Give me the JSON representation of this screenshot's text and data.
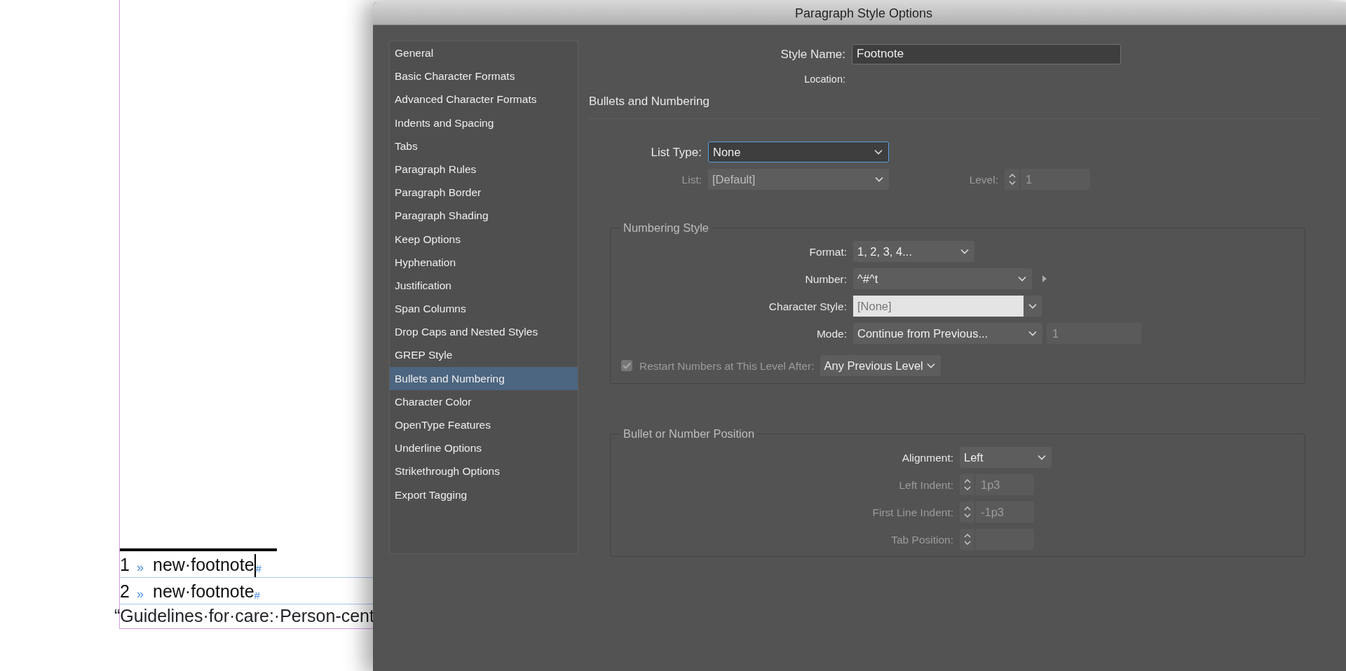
{
  "document": {
    "footnotes": [
      {
        "number": "1",
        "tab_mark": "»",
        "text": "new·footnote",
        "end_mark": "#",
        "cursor": true
      },
      {
        "number": "2",
        "tab_mark": "»",
        "text": "new·footnote",
        "end_mark": "#",
        "cursor": false
      }
    ],
    "body_text": "“Guidelines·for·care:·Person-cent"
  },
  "dialog": {
    "title": "Paragraph Style Options",
    "sidebar": {
      "items": [
        {
          "label": "General",
          "selected": false
        },
        {
          "label": "Basic Character Formats",
          "selected": false
        },
        {
          "label": "Advanced Character Formats",
          "selected": false
        },
        {
          "label": "Indents and Spacing",
          "selected": false
        },
        {
          "label": "Tabs",
          "selected": false
        },
        {
          "label": "Paragraph Rules",
          "selected": false
        },
        {
          "label": "Paragraph Border",
          "selected": false
        },
        {
          "label": "Paragraph Shading",
          "selected": false
        },
        {
          "label": "Keep Options",
          "selected": false
        },
        {
          "label": "Hyphenation",
          "selected": false
        },
        {
          "label": "Justification",
          "selected": false
        },
        {
          "label": "Span Columns",
          "selected": false
        },
        {
          "label": "Drop Caps and Nested Styles",
          "selected": false
        },
        {
          "label": "GREP Style",
          "selected": false
        },
        {
          "label": "Bullets and Numbering",
          "selected": true
        },
        {
          "label": "Character Color",
          "selected": false
        },
        {
          "label": "OpenType Features",
          "selected": false
        },
        {
          "label": "Underline Options",
          "selected": false
        },
        {
          "label": "Strikethrough Options",
          "selected": false
        },
        {
          "label": "Export Tagging",
          "selected": false
        }
      ]
    },
    "style_name": {
      "label": "Style Name:",
      "value": "Footnote"
    },
    "location": {
      "label": "Location:"
    },
    "section_title": "Bullets and Numbering",
    "list_type": {
      "label": "List Type:",
      "value": "None",
      "focused": true,
      "disabled": false
    },
    "list": {
      "label": "List:",
      "value": "[Default]",
      "disabled": true
    },
    "level": {
      "label": "Level:",
      "value": "1",
      "disabled": true
    },
    "numbering_style": {
      "title": "Numbering Style",
      "rows": [
        {
          "kind": "select",
          "label": "Format:",
          "value": "1, 2, 3, 4...",
          "disabled": false
        },
        {
          "kind": "select-flyout",
          "label": "Number:",
          "value": "^#^t",
          "disabled": false
        },
        {
          "kind": "select-light",
          "label": "Character Style:",
          "value": "[None]",
          "disabled": false
        },
        {
          "kind": "select-number",
          "label": "Mode:",
          "value": "Continue from Previous...",
          "number": "1",
          "disabled": false
        },
        {
          "kind": "checkbox",
          "label": "Restart Numbers at This Level After:",
          "checked": true,
          "value": "Any Previous Level",
          "disabled": true
        }
      ]
    },
    "position": {
      "title": "Bullet or Number Position",
      "rows": [
        {
          "kind": "select",
          "label": "Alignment:",
          "value": "Left",
          "disabled": false
        },
        {
          "kind": "stepper",
          "label": "Left Indent:",
          "value": "1p3",
          "disabled": true
        },
        {
          "kind": "stepper",
          "label": "First Line Indent:",
          "value": "-1p3",
          "disabled": true
        },
        {
          "kind": "stepper",
          "label": "Tab Position:",
          "disabled": true
        }
      ]
    }
  }
}
